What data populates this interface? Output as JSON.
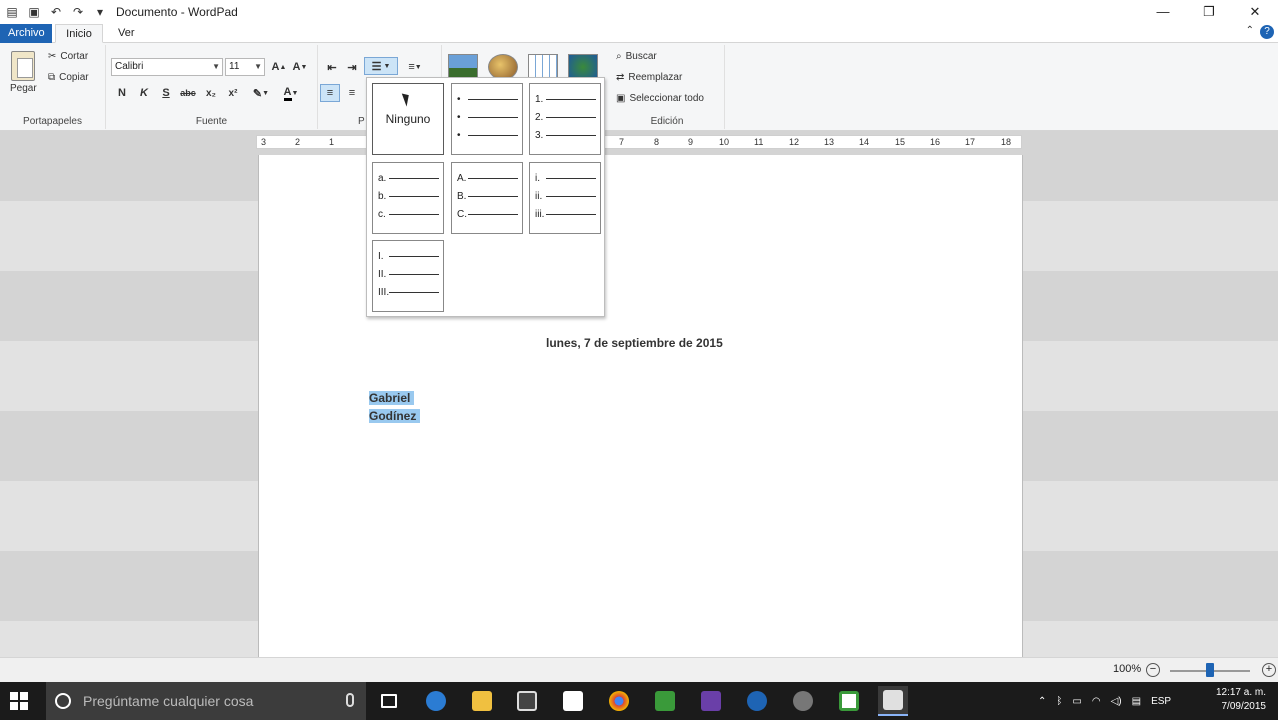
{
  "window": {
    "title": "Documento - WordPad",
    "controls": {
      "minimize": "—",
      "maximize": "❐",
      "close": "✕"
    }
  },
  "tabs": {
    "file": "Archivo",
    "home": "Inicio",
    "view": "Ver",
    "collapse": "⌃",
    "help": "?"
  },
  "ribbon": {
    "clipboard": {
      "paste": "Pegar",
      "cut": "Cortar",
      "copy": "Copiar",
      "label": "Portapapeles"
    },
    "font": {
      "family": "Calibri",
      "size": "11",
      "label": "Fuente",
      "bold": "N",
      "italic": "K",
      "underline": "S",
      "strike": "abc",
      "sub": "x₂",
      "sup": "x²"
    },
    "paragraph": {
      "label_partial": "P"
    },
    "edit": {
      "find": "Buscar",
      "replace": "Reemplazar",
      "select_all": "Seleccionar todo",
      "label": "Edición"
    }
  },
  "ruler": [
    "3",
    "2",
    "1",
    "7",
    "8",
    "9",
    "10",
    "11",
    "12",
    "13",
    "14",
    "15",
    "16",
    "17",
    "18"
  ],
  "dropdown": {
    "none_label": "Ninguno",
    "bullet": [
      "•",
      "•",
      "•"
    ],
    "numbers": [
      "1.",
      "2.",
      "3."
    ],
    "lower_alpha": [
      "a.",
      "b.",
      "c."
    ],
    "upper_alpha": [
      "A.",
      "B.",
      "C."
    ],
    "lower_roman": [
      "i.",
      "ii.",
      "iii."
    ],
    "upper_roman": [
      "I.",
      "II.",
      "III."
    ]
  },
  "document": {
    "date": "lunes, 7 de septiembre de 2015",
    "selected_lines": [
      "Gabriel",
      "Godínez"
    ]
  },
  "status": {
    "zoom": "100%",
    "zoom_minus": "−",
    "zoom_plus": "+",
    "zoom_level": 0.5
  },
  "taskbar": {
    "search_placeholder": "Pregúntame cualquier cosa",
    "tray_lang": "ESP",
    "time": "12:17 a. m.",
    "date": "7/09/2015"
  }
}
